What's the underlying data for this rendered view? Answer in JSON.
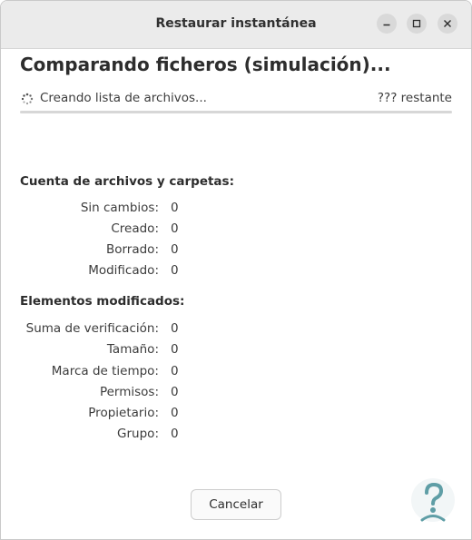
{
  "window": {
    "title": "Restaurar instantánea"
  },
  "heading": "Comparando ficheros (simulación)...",
  "status": {
    "text": "Creando lista de archivos...",
    "remaining": "??? restante",
    "progress_percent": 0,
    "accent_color": "#3584e4"
  },
  "file_counts": {
    "title": "Cuenta de archivos y carpetas:",
    "rows": [
      {
        "label": "Sin cambios:",
        "value": "0"
      },
      {
        "label": "Creado:",
        "value": "0"
      },
      {
        "label": "Borrado:",
        "value": "0"
      },
      {
        "label": "Modificado:",
        "value": "0"
      }
    ]
  },
  "modified_items": {
    "title": "Elementos modificados:",
    "rows": [
      {
        "label": "Suma de verificación:",
        "value": "0"
      },
      {
        "label": "Tamaño:",
        "value": "0"
      },
      {
        "label": "Marca de tiempo:",
        "value": "0"
      },
      {
        "label": "Permisos:",
        "value": "0"
      },
      {
        "label": "Propietario:",
        "value": "0"
      },
      {
        "label": "Grupo:",
        "value": "0"
      }
    ]
  },
  "actions": {
    "cancel_label": "Cancelar"
  },
  "icons": {
    "minimize": "minimize-icon",
    "maximize": "maximize-icon",
    "close": "close-icon",
    "spinner": "spinner-icon",
    "watermark": "question-person-logo"
  }
}
